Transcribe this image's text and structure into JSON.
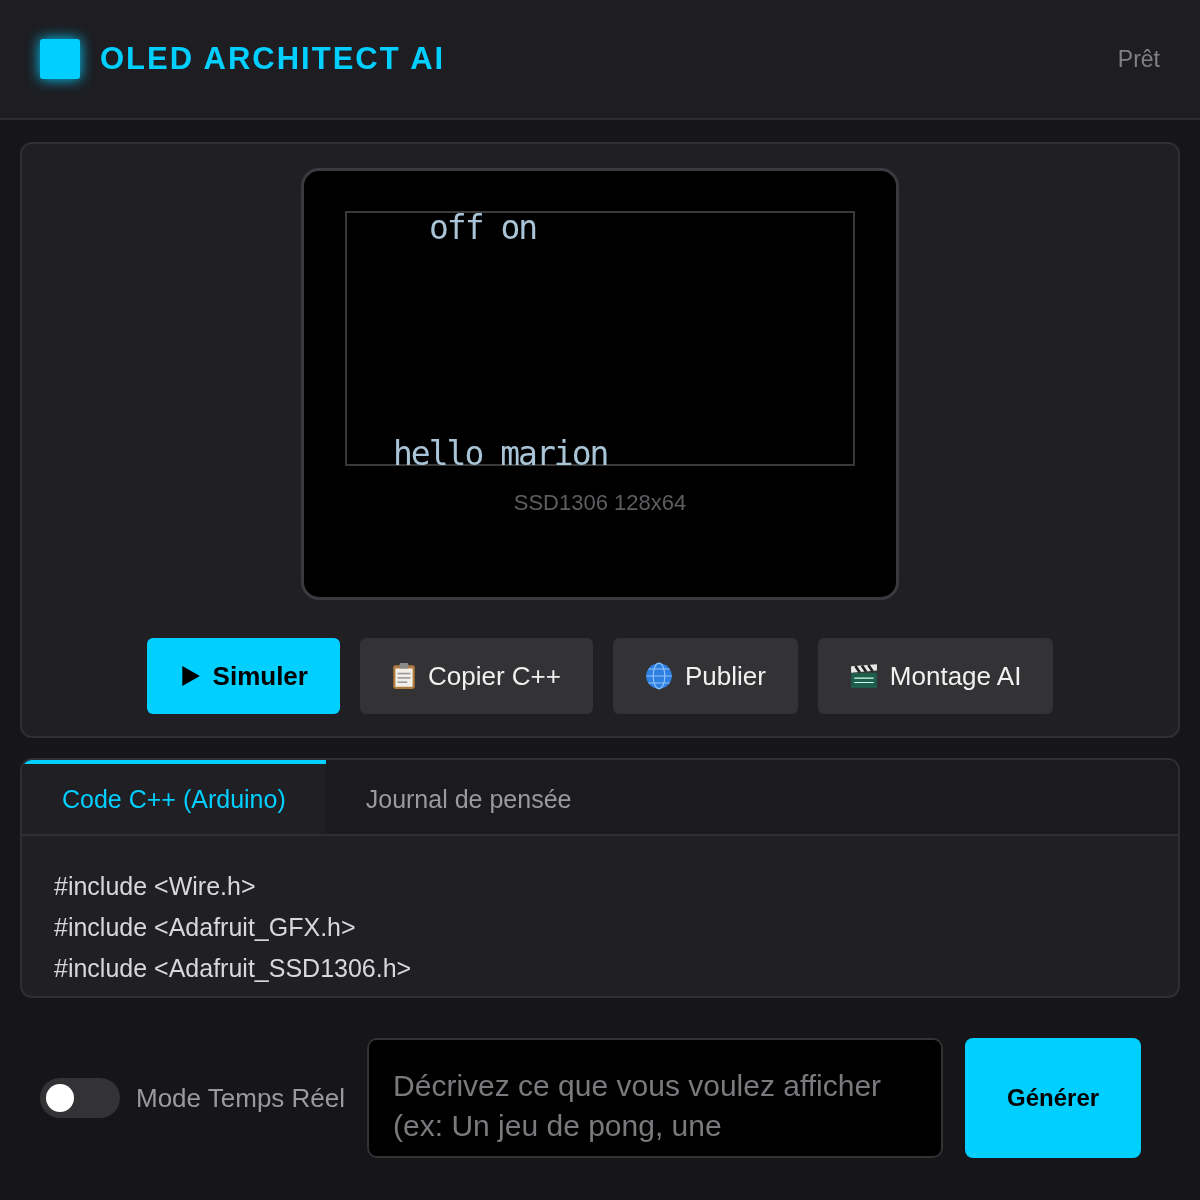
{
  "header": {
    "title": "OLED ARCHITECT AI",
    "status": "Prêt"
  },
  "display": {
    "lines": [
      {
        "text": "off on",
        "kind": "top"
      },
      {
        "text": "hello marion",
        "kind": "bottom"
      }
    ],
    "label": "SSD1306 128x64"
  },
  "actions": [
    {
      "label": "Simuler",
      "kind": "primary"
    },
    {
      "label": "Copier C++",
      "kind": "secondary"
    },
    {
      "label": "Publier",
      "kind": "secondary"
    },
    {
      "label": "Montage AI",
      "kind": "secondary"
    }
  ],
  "tabs": [
    {
      "label": "Code C++ (Arduino)",
      "selected": true
    },
    {
      "label": "Journal de pensée",
      "selected": false
    }
  ],
  "code": [
    "#include <Wire.h>",
    "#include <Adafruit_GFX.h>",
    "#include <Adafruit_SSD1306.h>"
  ],
  "realtime": {
    "label": "Mode Temps Réel",
    "on": false
  },
  "prompt": {
    "placeholder": "Décrivez ce que vous voulez afficher (ex: Un jeu de pong, une"
  },
  "generate": {
    "label": "Générer"
  }
}
